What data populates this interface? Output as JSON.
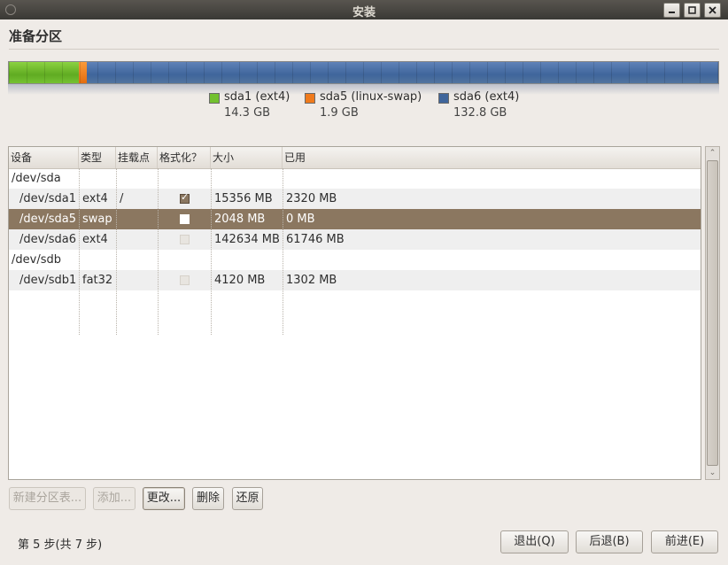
{
  "window": {
    "title": "安装"
  },
  "page": {
    "title": "准备分区"
  },
  "colors": {
    "ext4": "#60ab22",
    "swap": "#e36d10",
    "sda6": "#3f659b",
    "selection": "#8b7760"
  },
  "legend": [
    {
      "name": "sda1 (ext4)",
      "size": "14.3 GB",
      "color": "#73c12f"
    },
    {
      "name": "sda5 (linux-swap)",
      "size": "1.9 GB",
      "color": "#ef7a1c"
    },
    {
      "name": "sda6 (ext4)",
      "size": "132.8 GB",
      "color": "#3f659b"
    }
  ],
  "table": {
    "headers": [
      "设备",
      "类型",
      "挂载点",
      "格式化？",
      "大小",
      "已用"
    ],
    "rows": [
      {
        "device": "/dev/sda",
        "type": "",
        "mount": "",
        "format": "",
        "size": "",
        "used": ""
      },
      {
        "device": "/dev/sda1",
        "type": "ext4",
        "mount": "/",
        "format": "checked",
        "size": "15356 MB",
        "used": "2320 MB"
      },
      {
        "device": "/dev/sda5",
        "type": "swap",
        "mount": "",
        "format": "unchecked",
        "size": "2048 MB",
        "used": "0 MB"
      },
      {
        "device": "/dev/sda6",
        "type": "ext4",
        "mount": "",
        "format": "disabled",
        "size": "142634 MB",
        "used": "61746 MB"
      },
      {
        "device": "/dev/sdb",
        "type": "",
        "mount": "",
        "format": "",
        "size": "",
        "used": ""
      },
      {
        "device": "/dev/sdb1",
        "type": "fat32",
        "mount": "",
        "format": "disabled",
        "size": "4120 MB",
        "used": "1302 MB"
      }
    ]
  },
  "actions": {
    "new_table": "新建分区表...",
    "add": "添加...",
    "change": "更改...",
    "delete": "删除",
    "revert": "还原"
  },
  "footer": {
    "step": "第 5 步(共 7 步)",
    "quit": "退出(Q)",
    "back": "后退(B)",
    "forward": "前进(E)"
  }
}
